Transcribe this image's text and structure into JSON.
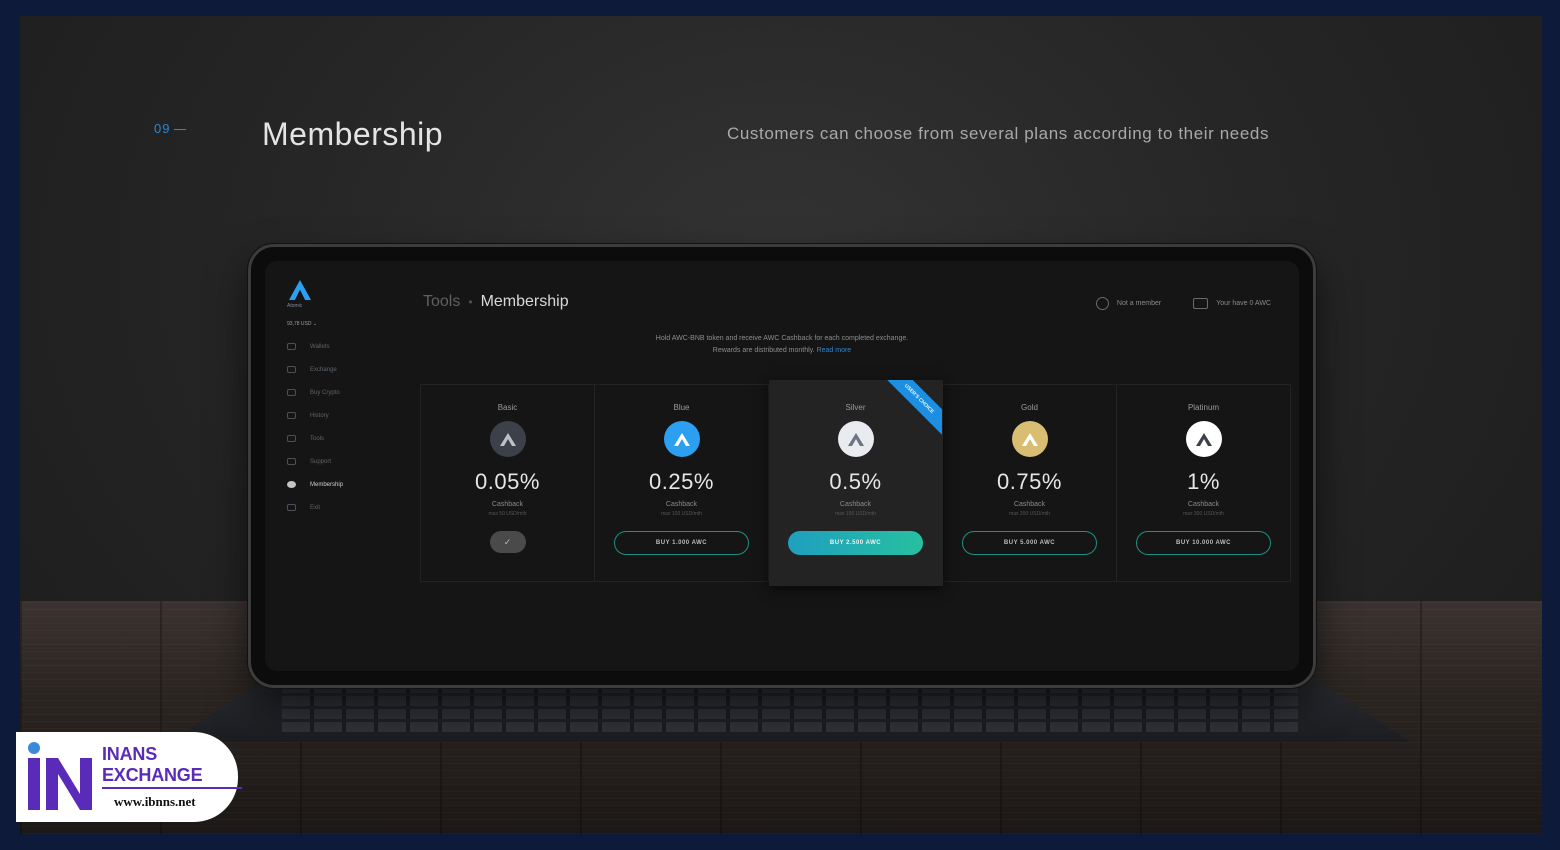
{
  "section": {
    "number": "09",
    "title": "Membership",
    "description": "Customers can choose from several plans according to their needs"
  },
  "app": {
    "logo_name": "Atomic",
    "balance": "93,78 USD",
    "nav": [
      {
        "label": "Wallets",
        "icon": "wallet-icon",
        "active": false
      },
      {
        "label": "Exchange",
        "icon": "exchange-icon",
        "active": false
      },
      {
        "label": "Buy Crypto",
        "icon": "card-icon",
        "active": false
      },
      {
        "label": "History",
        "icon": "history-icon",
        "active": false
      },
      {
        "label": "Tools",
        "icon": "tools-icon",
        "active": false
      },
      {
        "label": "Support",
        "icon": "support-icon",
        "active": false
      },
      {
        "label": "Membership",
        "icon": "membership-icon",
        "active": true
      },
      {
        "label": "Exit",
        "icon": "exit-icon",
        "active": false
      }
    ],
    "breadcrumb": {
      "parent": "Tools",
      "separator": "•",
      "current": "Membership"
    },
    "status": {
      "member": "Not a member",
      "balance": "Your have 0 AWC"
    },
    "notice": {
      "line1": "Hold AWC-BNB token and receive AWC Cashback for each completed exchange.",
      "line2": "Rewards are distributed monthly.",
      "link": "Read more"
    },
    "plans": [
      {
        "name": "Basic",
        "rate": "0.05%",
        "cashback": "Cashback",
        "max": "max 50 USD/mth",
        "coin_color": "#3c4048",
        "coin_fg": "#b9c2cf",
        "action": "check",
        "action_label": "✓"
      },
      {
        "name": "Blue",
        "rate": "0.25%",
        "cashback": "Cashback",
        "max": "max 100 USD/mth",
        "coin_color": "#2d9ff0",
        "coin_fg": "#ffffff",
        "action": "buy",
        "action_label": "BUY 1.000 AWC"
      },
      {
        "name": "Silver",
        "rate": "0.5%",
        "cashback": "Cashback",
        "max": "max 150 USD/mth",
        "coin_color": "#e8ebf0",
        "coin_fg": "#6a7382",
        "action": "buy-filled",
        "action_label": "BUY 2.500 AWC",
        "featured": true,
        "ribbon": "USER'S CHOICE"
      },
      {
        "name": "Gold",
        "rate": "0.75%",
        "cashback": "Cashback",
        "max": "max 200 USD/mth",
        "coin_color": "#d8bd72",
        "coin_fg": "#ffffff",
        "action": "buy",
        "action_label": "BUY 5.000 AWC"
      },
      {
        "name": "Platinum",
        "rate": "1%",
        "cashback": "Cashback",
        "max": "max 300 USD/mth",
        "coin_color": "#ffffff",
        "coin_fg": "#3c4048",
        "action": "buy",
        "action_label": "BUY 10.000 AWC"
      }
    ]
  },
  "watermark": {
    "brand": "INANS EXCHANGE",
    "url": "www.ibnns.net"
  },
  "colors": {
    "accent_blue": "#2c86d6",
    "teal": "#1f8f88",
    "border_navy": "#0d1a3a",
    "brand_purple": "#5a2bb8"
  }
}
